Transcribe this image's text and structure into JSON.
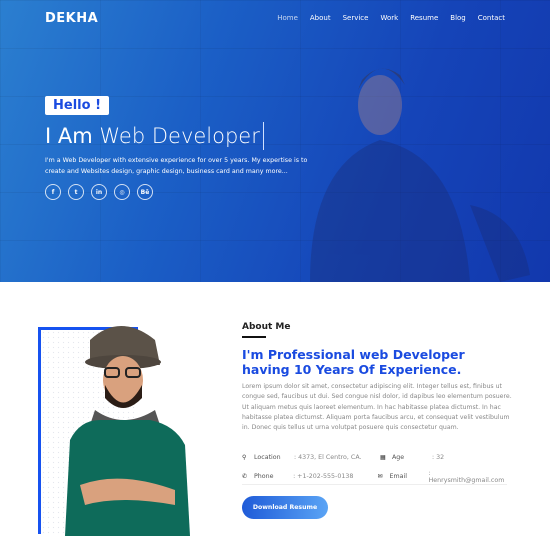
{
  "header": {
    "logo": "DEKHA",
    "nav": [
      "Home",
      "About",
      "Service",
      "Work",
      "Resume",
      "Blog",
      "Contact"
    ],
    "active": "Home"
  },
  "hero": {
    "greeting": "Hello !",
    "title_prefix": "I Am",
    "title_role": "Web Developer",
    "description": "I'm a Web Developer with extensive experience for over 5 years. My expertise is to create and Websites design, graphic design, business card and many more...",
    "social": [
      {
        "icon": "facebook-icon",
        "glyph": "f"
      },
      {
        "icon": "twitter-icon",
        "glyph": "t"
      },
      {
        "icon": "linkedin-icon",
        "glyph": "in"
      },
      {
        "icon": "instagram-icon",
        "glyph": "◎"
      },
      {
        "icon": "behance-icon",
        "glyph": "Bē"
      }
    ]
  },
  "about": {
    "heading": "About Me",
    "headline": "I'm Professional web Developer having 10 Years Of Experience.",
    "body": "Lorem ipsum dolor sit amet, consectetur adipiscing elit. Integer tellus est, finibus ut congue sed, faucibus ut dui. Sed congue nisl dolor, id dapibus leo elementum posuere. Ut aliquam metus quis laoreet elementum. In hac habitasse platea dictumst. In hac habitasse platea dictumst. Aliquam porta faucibus arcu, et consequat velit vestibulum in. Donec quis tellus ut urna volutpat posuere quis consectetur quam.",
    "info": {
      "location_label": "Location",
      "location": ": 4373, El Centro, CA.",
      "age_label": "Age",
      "age": ": 32",
      "phone_label": "Phone",
      "phone": ": +1-202-555-0138",
      "email_label": "Email",
      "email": ": Henrysmith@gmail.com"
    },
    "button": "Download Resume"
  },
  "colors": {
    "accent": "#1a4be0",
    "frame": "#1652f0"
  }
}
